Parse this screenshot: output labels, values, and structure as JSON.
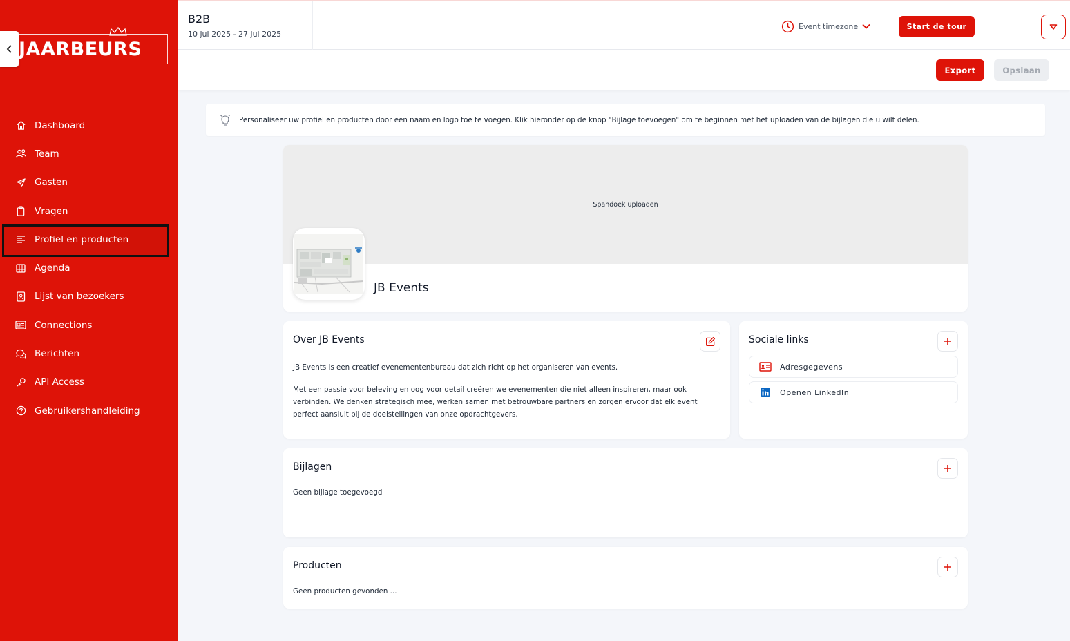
{
  "sidebar": {
    "logo_text": "JAARBEURS",
    "collapse_icon": "chevron-left-icon",
    "items": [
      {
        "label": "Dashboard",
        "icon": "home-icon"
      },
      {
        "label": "Team",
        "icon": "team-icon"
      },
      {
        "label": "Gasten",
        "icon": "send-icon"
      },
      {
        "label": "Vragen",
        "icon": "clipboard-icon"
      },
      {
        "label": "Profiel en producten",
        "icon": "list-icon",
        "active": true
      },
      {
        "label": "Agenda",
        "icon": "calendar-icon"
      },
      {
        "label": "Lijst van bezoekers",
        "icon": "contact-book-icon"
      },
      {
        "label": "Connections",
        "icon": "id-card-icon"
      },
      {
        "label": "Berichten",
        "icon": "chat-icon"
      },
      {
        "label": "API Access",
        "icon": "key-icon"
      },
      {
        "label": "Gebruikershandleiding",
        "icon": "help-icon"
      }
    ]
  },
  "header": {
    "event_name": "B2B",
    "event_dates": "10 jul 2025 - 27 jul 2025",
    "timezone_label": "Event timezone",
    "tour_button": "Start de tour"
  },
  "actionbar": {
    "export_label": "Export",
    "save_label": "Opslaan"
  },
  "banner": {
    "text": "Personaliseer uw profiel en producten door een naam en logo toe te voegen. Klik hieronder op de knop \"Bijlage toevoegen\" om te beginnen met het uploaden van de bijlagen die u wilt delen."
  },
  "profile": {
    "banner_upload_label": "Spandoek uploaden",
    "company_name": "JB Events"
  },
  "about": {
    "title": "Over JB Events",
    "paragraph_1": "JB Events is een creatief evenementenbureau dat zich richt op het organiseren van events.",
    "paragraph_2": "Met een passie voor beleving en oog voor detail creëren we evenementen die niet alleen inspireren, maar ook verbinden. We denken strategisch mee, werken samen met betrouwbare partners en zorgen ervoor dat elk event perfect aansluit bij de doelstellingen van onze opdrachtgevers."
  },
  "social": {
    "title": "Sociale links",
    "links": [
      {
        "label": "Adresgegevens",
        "icon": "address-card-icon"
      },
      {
        "label": "Openen LinkedIn",
        "icon": "linkedin-icon"
      }
    ]
  },
  "attachments": {
    "title": "Bijlagen",
    "empty_text": "Geen bijlage toegevoegd"
  },
  "products": {
    "title": "Producten",
    "empty_text": "Geen producten gevonden ..."
  },
  "colors": {
    "brand_red": "#de1308",
    "background": "#f4f6fa",
    "linkedin_blue": "#0a66c2"
  }
}
